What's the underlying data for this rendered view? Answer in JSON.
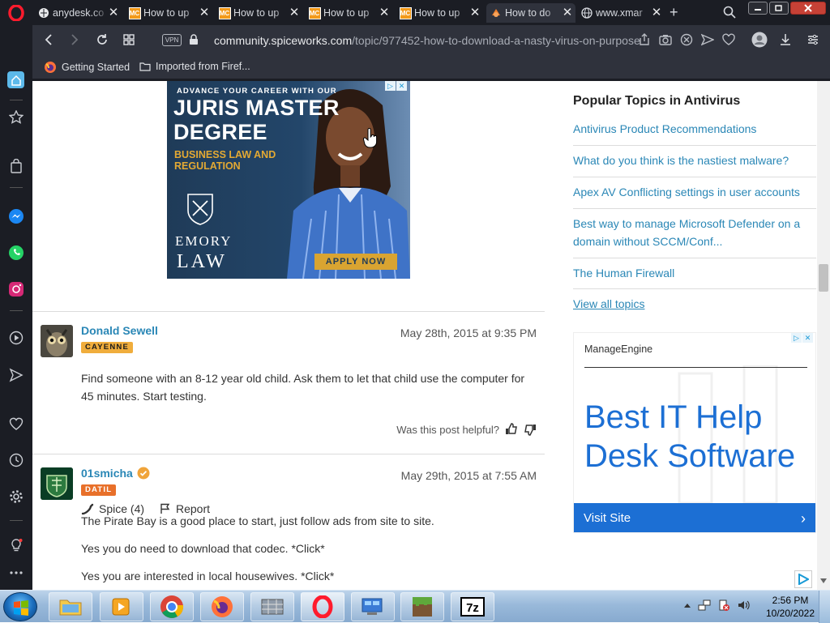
{
  "browser": {
    "tabs": [
      {
        "title": "anydesk.co",
        "favicon": "anydesk-icon",
        "active": false
      },
      {
        "title": "How to up",
        "favicon": "mc-icon",
        "active": false
      },
      {
        "title": "How to up",
        "favicon": "mc-icon",
        "active": false
      },
      {
        "title": "How to up",
        "favicon": "mc-icon",
        "active": false
      },
      {
        "title": "How to up",
        "favicon": "mc-icon",
        "active": false
      },
      {
        "title": "How to do",
        "favicon": "spiceworks-icon",
        "active": true
      },
      {
        "title": "www.xmar",
        "favicon": "globe-icon",
        "active": false
      }
    ],
    "vpn_label": "VPN",
    "url_domain": "community.spiceworks.com",
    "url_path": "/topic/977452-how-to-download-a-nasty-virus-on-purpose",
    "bookmarks": [
      {
        "label": "Getting Started",
        "icon": "firefox-icon"
      },
      {
        "label": "Imported from Firef...",
        "icon": "folder-icon"
      }
    ]
  },
  "ad_top": {
    "tagline": "ADVANCE YOUR CAREER WITH OUR",
    "headline_1": "JURIS MASTER",
    "headline_2": "DEGREE",
    "sub_1": "BUSINESS LAW AND",
    "sub_2": "REGULATION",
    "brand_1": "EMORY",
    "brand_2": "LAW",
    "cta": "APPLY NOW"
  },
  "posts": [
    {
      "author": "Donald Sewell",
      "rank": "CAYENNE",
      "rank_color": "#f0ad3c",
      "date": "May 28th, 2015 at 9:35 PM",
      "text": "Find someone with an 8-12 year old child.  Ask them to let that child use the computer for 45 minutes.  Start testing.",
      "spice_label": "Spice (4)",
      "report_label": "Report",
      "helpful_label": "Was this post helpful?"
    },
    {
      "author": "01smicha",
      "rank": "DATIL",
      "rank_color": "#e8702a",
      "date": "May 29th, 2015 at 7:55 AM",
      "lines": [
        "The Pirate Bay is a good place to start, just follow ads from site to site.",
        "Yes you do need to download that codec. *Click*",
        "Yes you are interested in local housewives. *Click*"
      ]
    }
  ],
  "sidebar_right": {
    "heading": "Popular Topics in Antivirus",
    "topics": [
      "Antivirus Product Recommendations",
      "What do you think is the nastiest malware?",
      "Apex AV Conflicting settings in user accounts",
      "Best way to manage Microsoft Defender on a domain without SCCM/Conf...",
      "The Human Firewall"
    ],
    "view_all": "View all topics"
  },
  "ad_side": {
    "brand": "ManageEngine",
    "headline_1": "Best IT Help",
    "headline_2": "Desk Software",
    "cta": "Visit Site"
  },
  "taskbar": {
    "time": "2:56 PM",
    "date": "10/20/2022",
    "apps": [
      "explorer",
      "media-player",
      "chrome",
      "firefox",
      "app-grid",
      "opera",
      "control-panel",
      "minecraft",
      "7zip"
    ]
  }
}
